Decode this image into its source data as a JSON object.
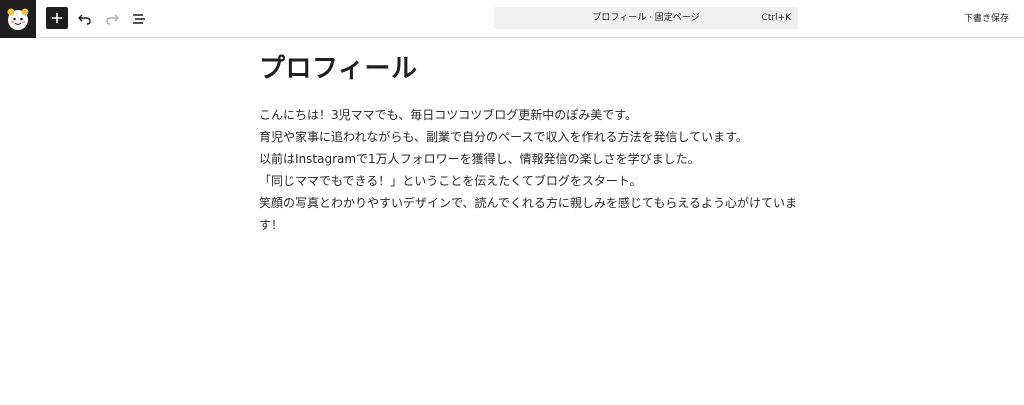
{
  "toolbar": {
    "title": "プロフィール · 固定ページ",
    "shortcut": "Ctrl+K",
    "save_draft": "下書き保存"
  },
  "post": {
    "title": "プロフィール",
    "paragraphs": [
      "こんにちは！3児ママでも、毎日コツコツブログ更新中のぽみ美です。",
      "育児や家事に追われながらも、副業で自分のペースで収入を作れる方法を発信しています。",
      "以前はInstagramで1万人フォロワーを獲得し、情報発信の楽しさを学びました。",
      "「同じママでもできる！」ということを伝えたくてブログをスタート。",
      "笑顔の写真とわかりやすいデザインで、読んでくれる方に親しみを感じてもらえるよう心がけていま",
      "す！"
    ]
  },
  "icons": {
    "site": "site-logo-icon",
    "add": "plus-icon",
    "undo": "undo-icon",
    "redo": "redo-icon",
    "outline": "list-view-icon"
  }
}
